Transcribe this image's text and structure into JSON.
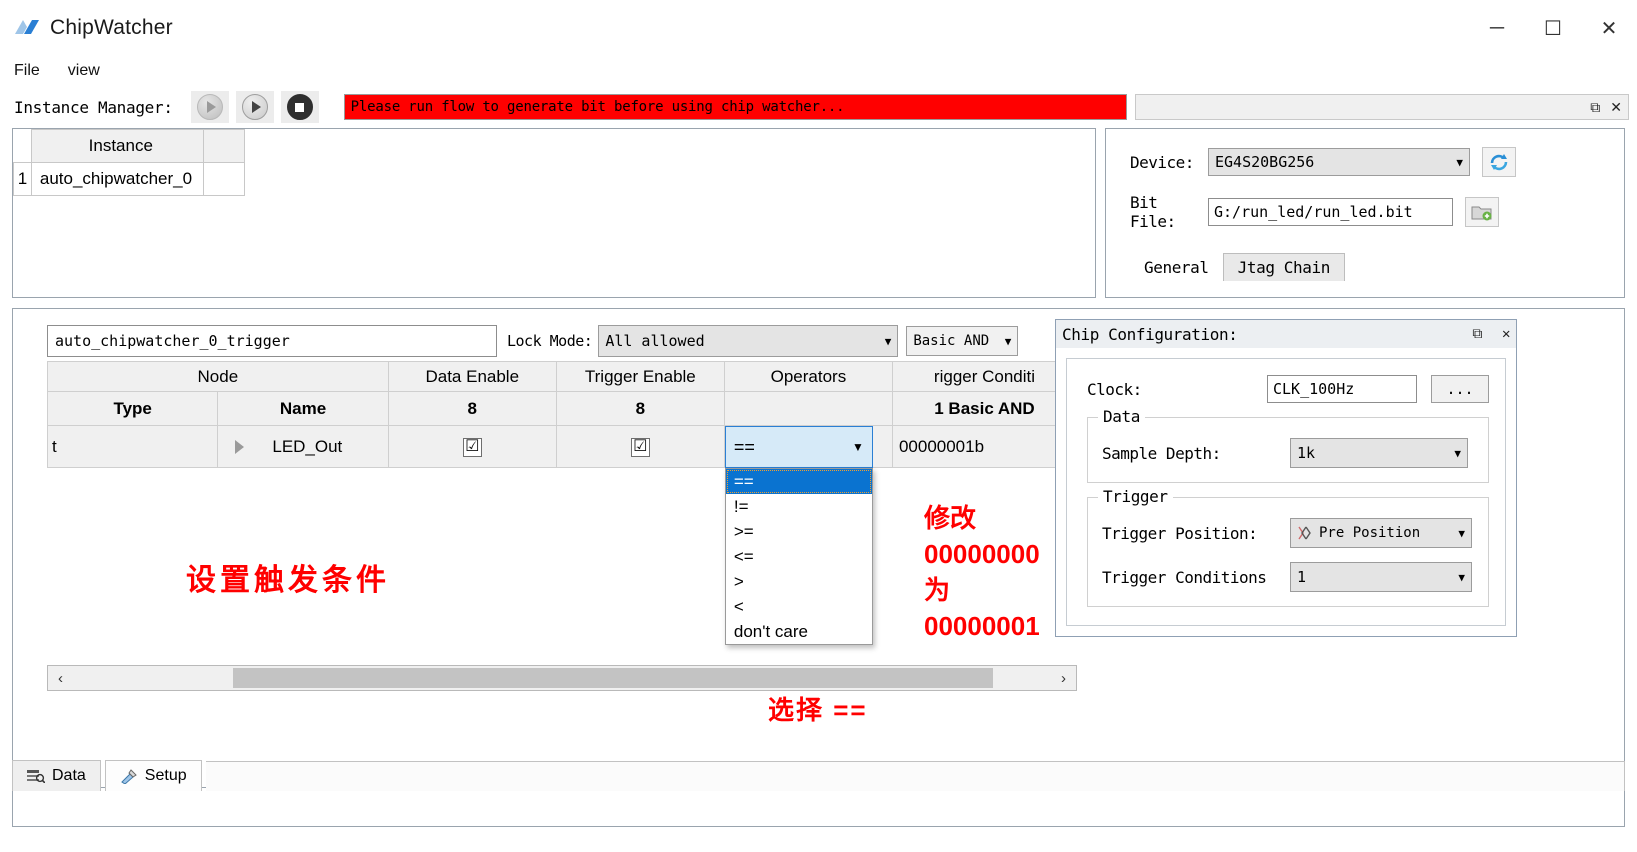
{
  "window": {
    "title": "ChipWatcher",
    "logo_icon": "chipwatcher-logo-icon",
    "minimize": "─",
    "maximize": "☐",
    "close": "✕"
  },
  "menubar": {
    "items": [
      {
        "label": "File"
      },
      {
        "label": "view"
      }
    ]
  },
  "toolbar": {
    "label": "Instance Manager:",
    "buttons": [
      {
        "name": "run-button",
        "icon": "play-circle-disabled-icon"
      },
      {
        "name": "step-button",
        "icon": "play-circle-icon"
      },
      {
        "name": "stop-button",
        "icon": "stop-circle-icon"
      }
    ],
    "status_message": "Please run flow to generate bit before using chip watcher...",
    "status_bg": "#ff0000",
    "dock_restore": "⧉",
    "dock_close": "✕"
  },
  "instance_table": {
    "headers": [
      "",
      "Instance",
      ""
    ],
    "rows": [
      {
        "num": "1",
        "name": "auto_chipwatcher_0",
        "extra": ""
      }
    ]
  },
  "device_panel": {
    "device_label": "Device:",
    "device_value": "EG4S20BG256",
    "refresh_icon": "refresh-icon",
    "bitfile_label": "Bit File:",
    "bitfile_value": "G:/run_led/run_led.bit",
    "browse_icon": "open-folder-icon",
    "tabs": [
      {
        "label": "General",
        "active": false
      },
      {
        "label": "Jtag Chain",
        "active": true
      }
    ]
  },
  "trigger_pane": {
    "name_value": "auto_chipwatcher_0_trigger",
    "lock_mode_label": "Lock Mode:",
    "lock_mode_value": "All allowed",
    "basic_value": "Basic AND",
    "group_headers": [
      "Node",
      "Data Enable",
      "Trigger Enable",
      "Operators",
      "rigger Conditi"
    ],
    "column_headers": [
      "Type",
      "Name",
      "8",
      "8",
      "",
      "1 Basic AND"
    ],
    "row": {
      "type": "t",
      "expand_icon": "expand-arrow-icon",
      "name": "LED_Out",
      "data_enable": "☑",
      "trigger_enable": "☑",
      "operator": "==",
      "condition_value": "00000001b"
    },
    "operator_options": [
      "==",
      "!=",
      ">=",
      "<=",
      ">",
      "<",
      "don't care"
    ],
    "operator_selected": "==",
    "scroll_left": "‹",
    "scroll_right": "›"
  },
  "chip_configuration": {
    "title": "Chip Configuration:",
    "dock_restore": "⧉",
    "dock_close": "✕",
    "clock_label": "Clock:",
    "clock_value": "CLK_100Hz",
    "clock_browse": "...",
    "data_group": "Data",
    "sample_depth_label": "Sample Depth:",
    "sample_depth_value": "1k",
    "trigger_group": "Trigger",
    "trigger_position_label": "Trigger Position:",
    "trigger_position_value": "Pre Position",
    "trigger_position_icon": "pre-position-icon",
    "trigger_conditions_label": "Trigger Conditions",
    "trigger_conditions_value": "1"
  },
  "annotations": {
    "set_trigger": "设置触发条件",
    "modify": "修改\n00000000\n为\n00000001",
    "select": "选择 ==",
    "color": "#ff0000"
  },
  "bottom_tabs": [
    {
      "label": "Data",
      "icon": "data-table-icon",
      "active": false
    },
    {
      "label": "Setup",
      "icon": "setup-tools-icon",
      "active": true
    }
  ]
}
